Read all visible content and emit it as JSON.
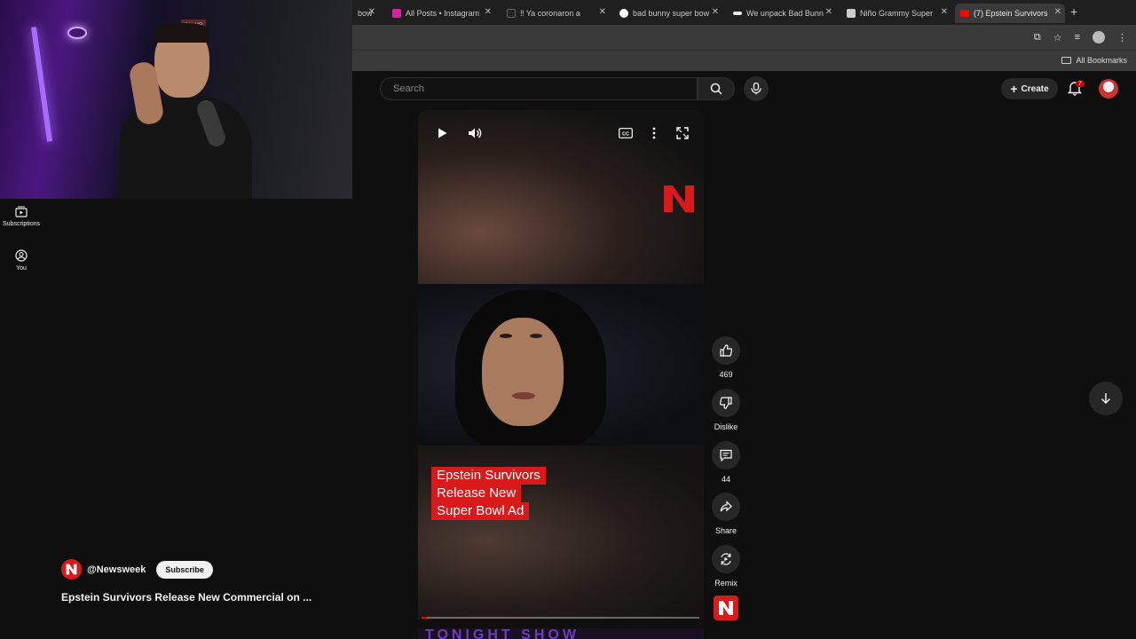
{
  "browser": {
    "tabs": [
      {
        "label": "bow",
        "favicon_color": "#444444"
      },
      {
        "label": "All Posts • Instagram",
        "favicon_color": "#d6249f"
      },
      {
        "label": "‼ Ya coronaron a",
        "favicon_color": "#222222"
      },
      {
        "label": "bad bunny super bow",
        "favicon_color": "#4285f4"
      },
      {
        "label": "We unpack Bad Bunn",
        "favicon_color": "#e8e8e8"
      },
      {
        "label": "Niño Grammy Super",
        "favicon_color": "#cccccc"
      },
      {
        "label": "(7) Epstein Survivors",
        "favicon_color": "#ff0000"
      }
    ],
    "new_tab_label": "+",
    "bookmarks_label": "All Bookmarks"
  },
  "youtube": {
    "search_placeholder": "Search",
    "create_label": "Create",
    "notification_count": "7",
    "nav": [
      {
        "label": "Subscriptions"
      },
      {
        "label": "You"
      }
    ]
  },
  "webcam": {
    "sign_text": "ON AIR"
  },
  "short": {
    "caption_lines": [
      "Epstein Survivors",
      "Release New",
      "Super Bowl Ad"
    ],
    "next_preview_text": "TONIGHT SHOW",
    "progress": 0.02
  },
  "actions": {
    "like_count": "469",
    "dislike_label": "Dislike",
    "comment_count": "44",
    "share_label": "Share",
    "remix_label": "Remix"
  },
  "channel": {
    "handle": "@Newsweek",
    "subscribe_label": "Subscribe",
    "video_title": "Epstein Survivors Release New Commercial on ..."
  },
  "colors": {
    "accent": "#d91a1a",
    "background": "#0f0f0f"
  }
}
